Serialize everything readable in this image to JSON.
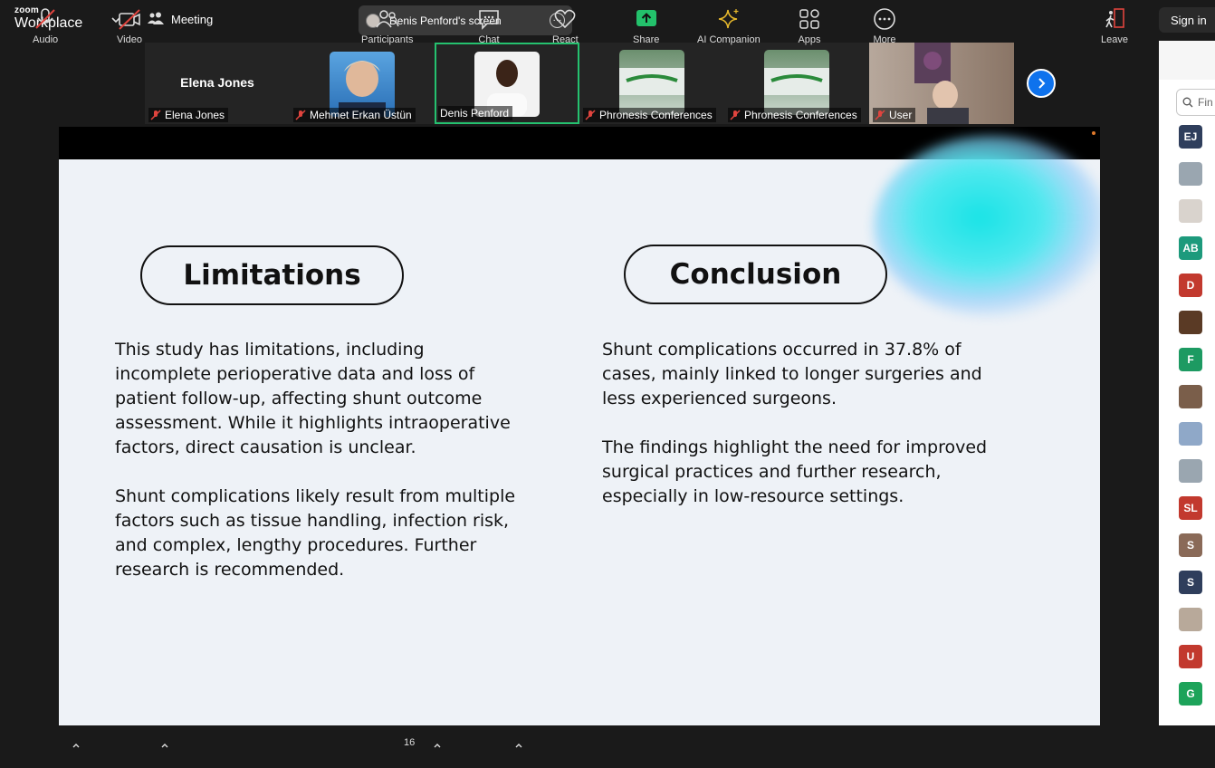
{
  "app": {
    "logo_top": "zoom",
    "logo_bottom": "Workplace"
  },
  "header": {
    "meeting_label": "Meeting",
    "screen_label": "Denis Penford's screen",
    "signin_label": "Sign in"
  },
  "participants_strip": [
    {
      "name": "Elena Jones",
      "big_name": "Elena Jones",
      "muted": true
    },
    {
      "name": "Mehmet Erkan Üstün",
      "muted": true
    },
    {
      "name": "Denis Penford",
      "muted": false,
      "active": true
    },
    {
      "name": "Phronesis Conferences",
      "muted": true
    },
    {
      "name": "Phronesis Conferences",
      "muted": true
    },
    {
      "name": "User",
      "muted": true
    }
  ],
  "slide": {
    "left_heading": "Limitations",
    "right_heading": "Conclusion",
    "left_paragraphs": [
      "This study has limitations, including incomplete perioperative data and loss of patient follow-up, affecting shunt outcome assessment. While it highlights intraoperative factors, direct causation is unclear.",
      "Shunt complications likely result from multiple factors such as tissue handling, infection risk, and complex, lengthy procedures. Further research is recommended."
    ],
    "right_paragraphs": [
      "Shunt complications occurred in 37.8% of cases, mainly linked to longer surgeries and less experienced surgeons.",
      "The findings highlight the need for improved surgical practices and further research, especially in low-resource settings."
    ]
  },
  "side_panel": {
    "search_placeholder": "Fin",
    "avatars": [
      {
        "initials": "EJ",
        "color": "#2f3e5c"
      },
      {
        "initials": "",
        "color": "#9aa6b0"
      },
      {
        "initials": "",
        "color": "#d9d3cd"
      },
      {
        "initials": "AB",
        "color": "#1d9a7c"
      },
      {
        "initials": "D",
        "color": "#c2392e"
      },
      {
        "initials": "",
        "color": "#5a3a25"
      },
      {
        "initials": "F",
        "color": "#1d9a62"
      },
      {
        "initials": "",
        "color": "#7a5e4a"
      },
      {
        "initials": "",
        "color": "#8fa8c8"
      },
      {
        "initials": "",
        "color": "#9aa6b0"
      },
      {
        "initials": "SL",
        "color": "#c2392e"
      },
      {
        "initials": "S",
        "color": "#8a6a58"
      },
      {
        "initials": "S",
        "color": "#2f3e5c"
      },
      {
        "initials": "",
        "color": "#b8a99a"
      },
      {
        "initials": "U",
        "color": "#c2392e"
      },
      {
        "initials": "G",
        "color": "#1da35a"
      }
    ]
  },
  "toolbar": {
    "audio": "Audio",
    "video": "Video",
    "participants": "Participants",
    "participant_count": "16",
    "chat": "Chat",
    "react": "React",
    "share": "Share",
    "ai_companion": "AI Companion",
    "apps": "Apps",
    "more": "More",
    "leave": "Leave"
  }
}
